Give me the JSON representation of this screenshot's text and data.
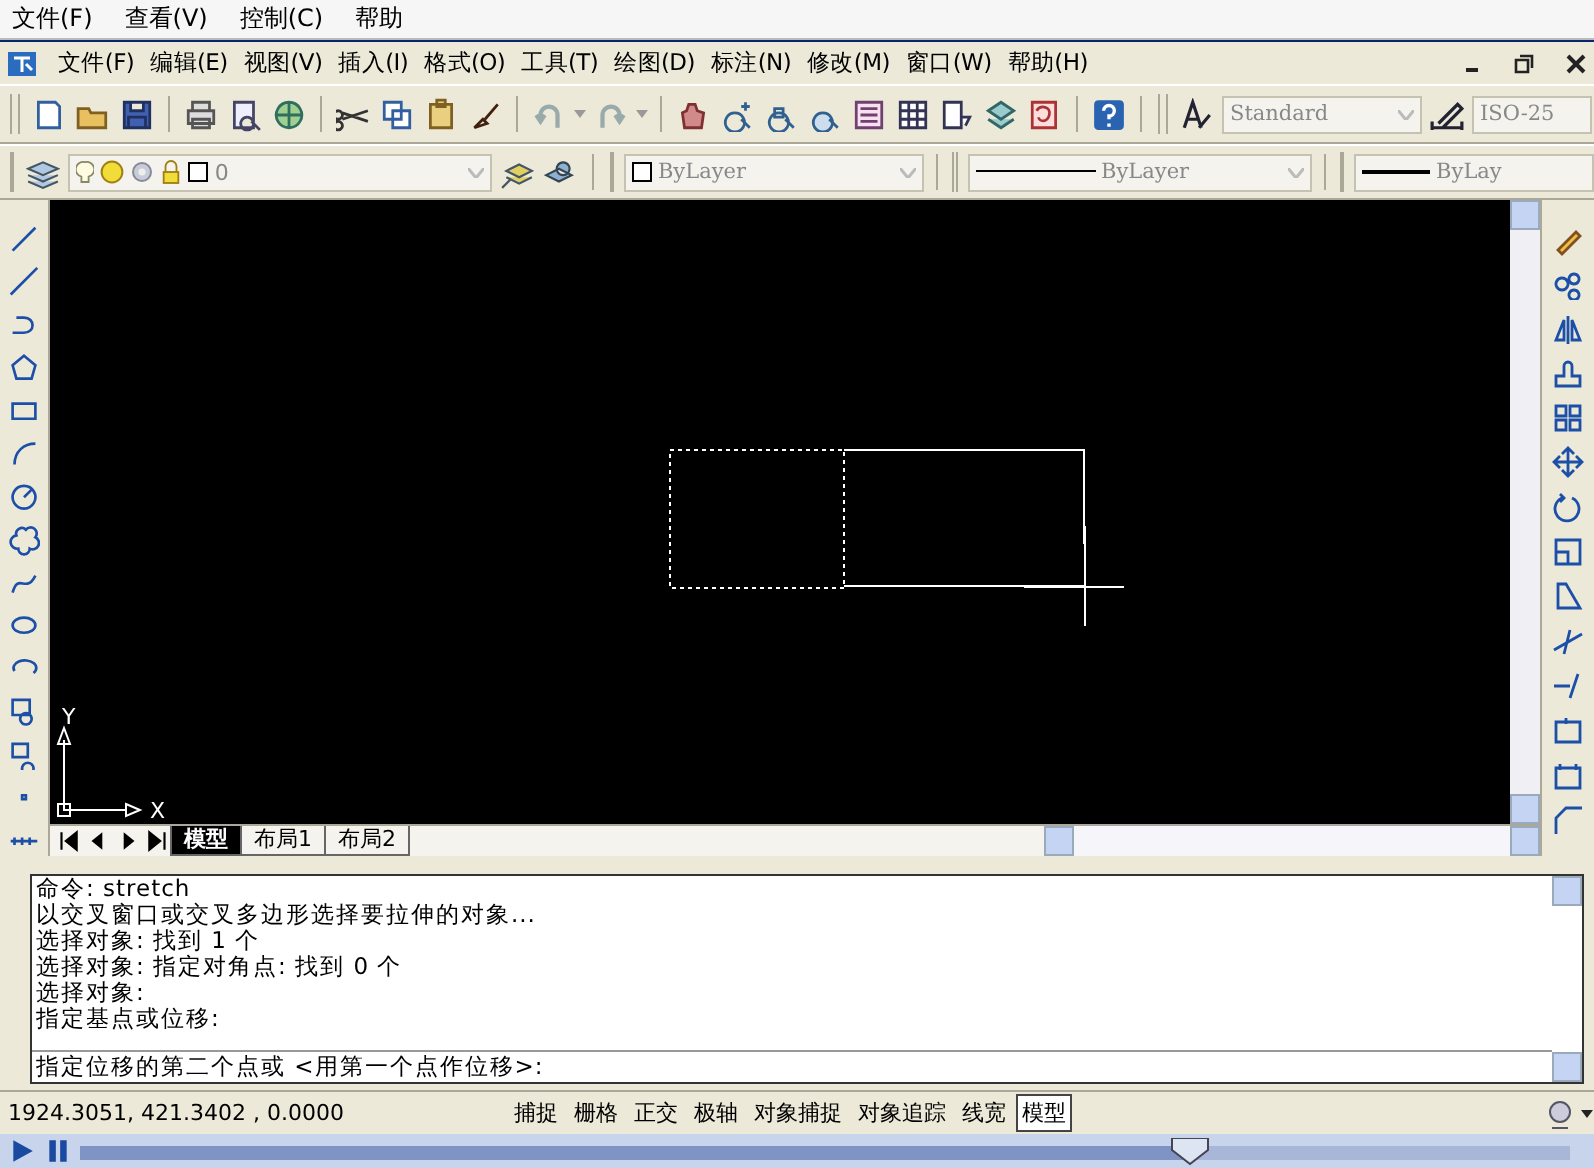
{
  "app_menu": [
    {
      "label": "文件(F)"
    },
    {
      "label": "查看(V)"
    },
    {
      "label": "控制(C)"
    },
    {
      "label": "帮助"
    }
  ],
  "cad_menu": [
    {
      "label": "文件(F)"
    },
    {
      "label": "编辑(E)"
    },
    {
      "label": "视图(V)"
    },
    {
      "label": "插入(I)"
    },
    {
      "label": "格式(O)"
    },
    {
      "label": "工具(T)"
    },
    {
      "label": "绘图(D)"
    },
    {
      "label": "标注(N)"
    },
    {
      "label": "修改(M)"
    },
    {
      "label": "窗口(W)"
    },
    {
      "label": "帮助(H)"
    }
  ],
  "standard_toolbar": {
    "text_style": "Standard",
    "dim_style": "ISO-25"
  },
  "layers_toolbar": {
    "layer": "0"
  },
  "properties_toolbar": {
    "color_setting": "ByLayer",
    "linetype": "ByLayer",
    "lineweight": "ByLay"
  },
  "canvas": {
    "ucs_y": "Y",
    "ucs_x": "X"
  },
  "layout_tabs": [
    {
      "label": "模型",
      "selected": true
    },
    {
      "label": "布局1",
      "selected": false
    },
    {
      "label": "布局2",
      "selected": false
    }
  ],
  "command": {
    "history": [
      "命令: stretch",
      "以交叉窗口或交叉多边形选择要拉伸的对象...",
      "选择对象: 找到 1 个",
      "选择对象: 指定对角点: 找到 0 个",
      "选择对象:",
      "指定基点或位移:"
    ],
    "prompt": "指定位移的第二个点或 <用第一个点作位移>:"
  },
  "status_bar": {
    "coordinates": "1924.3051, 421.3402 , 0.0000",
    "toggles": [
      {
        "label": "捕捉",
        "on": false
      },
      {
        "label": "栅格",
        "on": false
      },
      {
        "label": "正交",
        "on": false
      },
      {
        "label": "极轴",
        "on": false
      },
      {
        "label": "对象捕捉",
        "on": false
      },
      {
        "label": "对象追踪",
        "on": false
      },
      {
        "label": "线宽",
        "on": false
      },
      {
        "label": "模型",
        "on": true
      }
    ]
  },
  "player": {
    "level": 0.745
  }
}
